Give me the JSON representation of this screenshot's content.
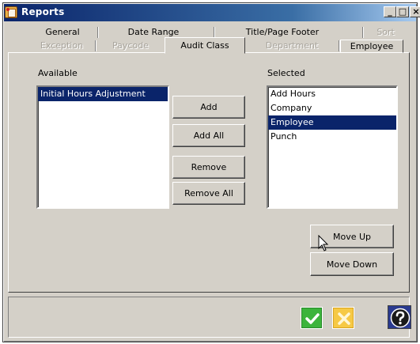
{
  "window": {
    "title": "Reports",
    "caption_buttons": {
      "minimize": "_",
      "maximize": "□",
      "close": "×"
    }
  },
  "tabs": {
    "row1": [
      {
        "label": "General",
        "enabled": true
      },
      {
        "label": "Date Range",
        "enabled": true
      },
      {
        "label": "Title/Page Footer",
        "enabled": true
      },
      {
        "label": "Sort",
        "enabled": false
      }
    ],
    "row2": [
      {
        "label": "Exception",
        "enabled": false
      },
      {
        "label": "Paycode",
        "enabled": false
      },
      {
        "label": "Audit Class",
        "enabled": true,
        "active": true
      },
      {
        "label": "Department",
        "enabled": false
      },
      {
        "label": "Employee",
        "enabled": true
      }
    ]
  },
  "available": {
    "label": "Available",
    "items": [
      {
        "text": "Initial Hours Adjustment",
        "selected": true
      }
    ]
  },
  "selected": {
    "label": "Selected",
    "items": [
      {
        "text": "Add Hours",
        "selected": false
      },
      {
        "text": "Company",
        "selected": false
      },
      {
        "text": "Employee",
        "selected": true
      },
      {
        "text": "Punch",
        "selected": false
      }
    ]
  },
  "buttons": {
    "add": "Add",
    "add_all": "Add All",
    "remove": "Remove",
    "remove_all": "Remove All",
    "move_up": "Move Up",
    "move_down": "Move Down"
  },
  "footer_icons": {
    "ok": "check-icon",
    "cancel": "x-icon",
    "help": "question-icon"
  },
  "colors": {
    "titlebar": "#0a246a",
    "selection": "#0a246a",
    "ok": "#3cb43c",
    "cancel": "#f6c945",
    "help": "#2a3a8f"
  }
}
